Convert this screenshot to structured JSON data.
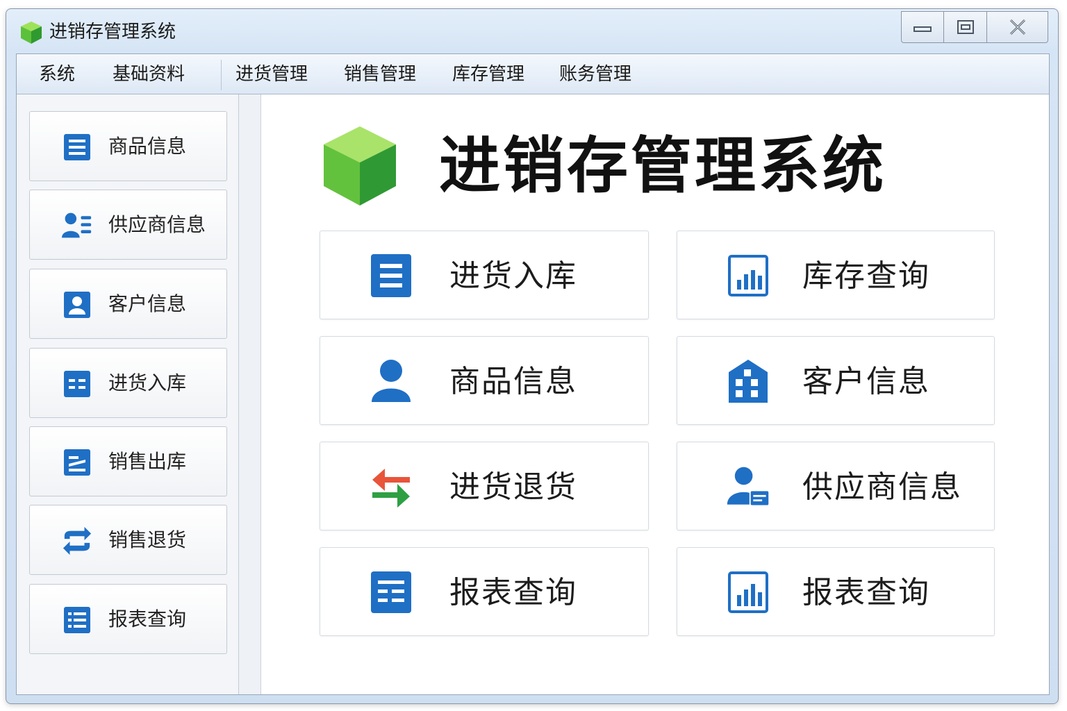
{
  "window": {
    "title": "进销存管理系统",
    "accent_color": "#1f6fc5",
    "controls": {
      "minimize_icon": "minimize-icon",
      "restore_icon": "restore-icon",
      "close_icon": "close-icon"
    }
  },
  "menubar": {
    "items": [
      {
        "label": "系统"
      },
      {
        "label": "基础资料"
      },
      {
        "label": "进货管理"
      },
      {
        "label": "销售管理"
      },
      {
        "label": "库存管理"
      },
      {
        "label": "账务管理"
      }
    ]
  },
  "sidebar": {
    "items": [
      {
        "label": "商品信息",
        "icon": "document-list-icon"
      },
      {
        "label": "供应商信息",
        "icon": "users-list-icon"
      },
      {
        "label": "客户信息",
        "icon": "user-card-icon"
      },
      {
        "label": "进货入库",
        "icon": "table-grid-icon"
      },
      {
        "label": "销售出库",
        "icon": "document-edit-icon"
      },
      {
        "label": "销售退货",
        "icon": "swap-arrows-icon"
      },
      {
        "label": "报表查询",
        "icon": "report-list-icon"
      }
    ]
  },
  "main": {
    "heading": "进销存管理系统",
    "logo_icon": "green-cube-icon",
    "tiles": [
      {
        "label": "进货入库",
        "icon": "document-list-icon"
      },
      {
        "label": "库存查询",
        "icon": "bar-chart-icon"
      },
      {
        "label": "商品信息",
        "icon": "user-icon"
      },
      {
        "label": "客户信息",
        "icon": "building-icon"
      },
      {
        "label": "进货退货",
        "icon": "swap-arrows-icon"
      },
      {
        "label": "供应商信息",
        "icon": "user-card-icon"
      },
      {
        "label": "报表查询",
        "icon": "table-grid-icon"
      },
      {
        "label": "报表查询",
        "icon": "bar-chart-icon"
      }
    ]
  }
}
